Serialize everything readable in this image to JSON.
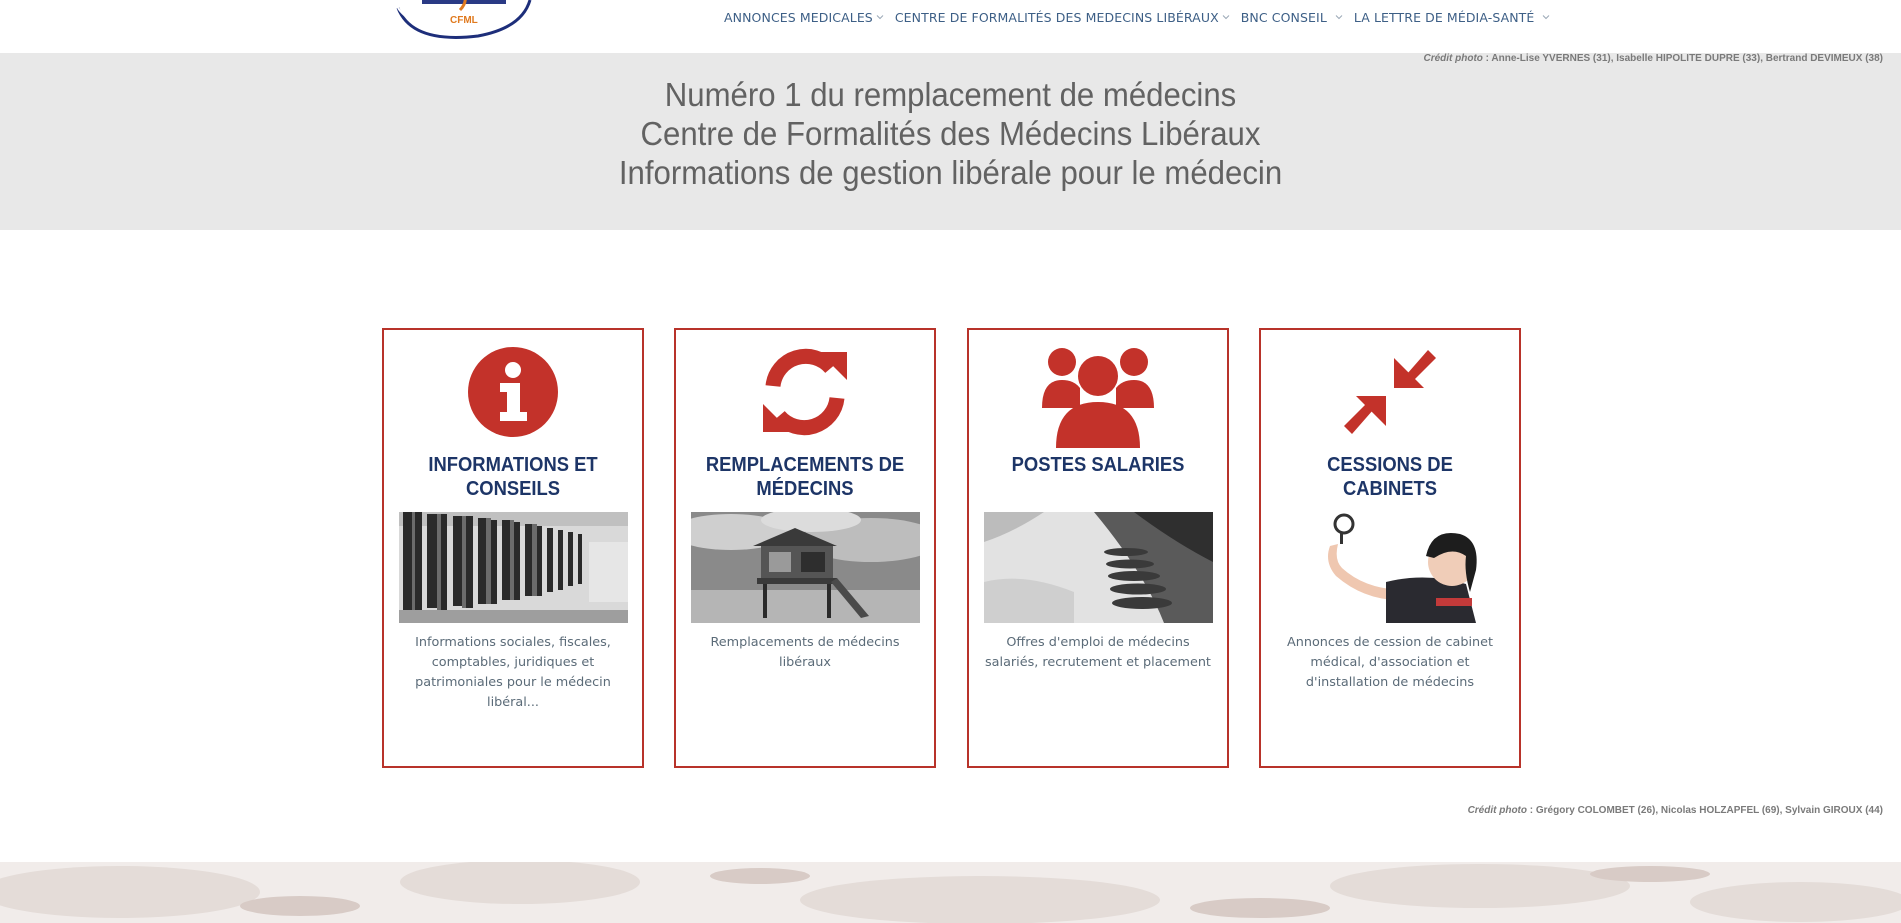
{
  "header": {
    "logo_text": "CFML",
    "nav": [
      {
        "label": "ANNONCES MEDICALES",
        "has_dropdown": true
      },
      {
        "label": "CENTRE DE FORMALITÉS DES MEDECINS LIBÉRAUX",
        "has_dropdown": true
      },
      {
        "label": "BNC CONSEIL",
        "has_dropdown": true
      },
      {
        "label": "LA LETTRE DE MÉDIA-SANTÉ",
        "has_dropdown": true
      }
    ]
  },
  "hero": {
    "credit_label": "Crédit photo",
    "credit_text": " : Anne-Lise YVERNES (31), Isabelle HIPOLITE DUPRE (33), Bertrand DEVIMEUX (38)",
    "lines": [
      "Numéro 1 du remplacement de médecins",
      "Centre de Formalités des Médecins Libéraux",
      "Informations de gestion libérale pour le médecin"
    ]
  },
  "cards": [
    {
      "icon": "info-icon",
      "title": "INFORMATIONS ET CONSEILS",
      "photo": "archive-shelves-photo",
      "description": "Informations sociales, fiscales, comptables, juridiques et patrimoniales pour le médecin libéral..."
    },
    {
      "icon": "refresh-icon",
      "title": "REMPLACEMENTS DE MÉDECINS",
      "photo": "lifeguard-tower-photo",
      "description": "Remplacements de médecins libéraux"
    },
    {
      "icon": "users-icon",
      "title": "POSTES SALARIES",
      "photo": "boats-river-photo",
      "description": "Offres d'emploi de médecins salariés, recrutement et placement"
    },
    {
      "icon": "compress-arrows-icon",
      "title": "CESSIONS DE CABINETS",
      "photo": "child-magnifier-photo",
      "description": "Annonces de cession de cabinet médical, d'association et d'installation de médecins"
    }
  ],
  "bottom_credit": {
    "label": "Crédit photo",
    "text": " : Grégory COLOMBET (26), Nicolas HOLZAPFEL (69), Sylvain GIROUX (44)"
  },
  "colors": {
    "accent_red": "#b8332a",
    "title_navy": "#1d3567",
    "nav_blue": "#3d5f86",
    "hero_bg": "#e8e8e8"
  }
}
